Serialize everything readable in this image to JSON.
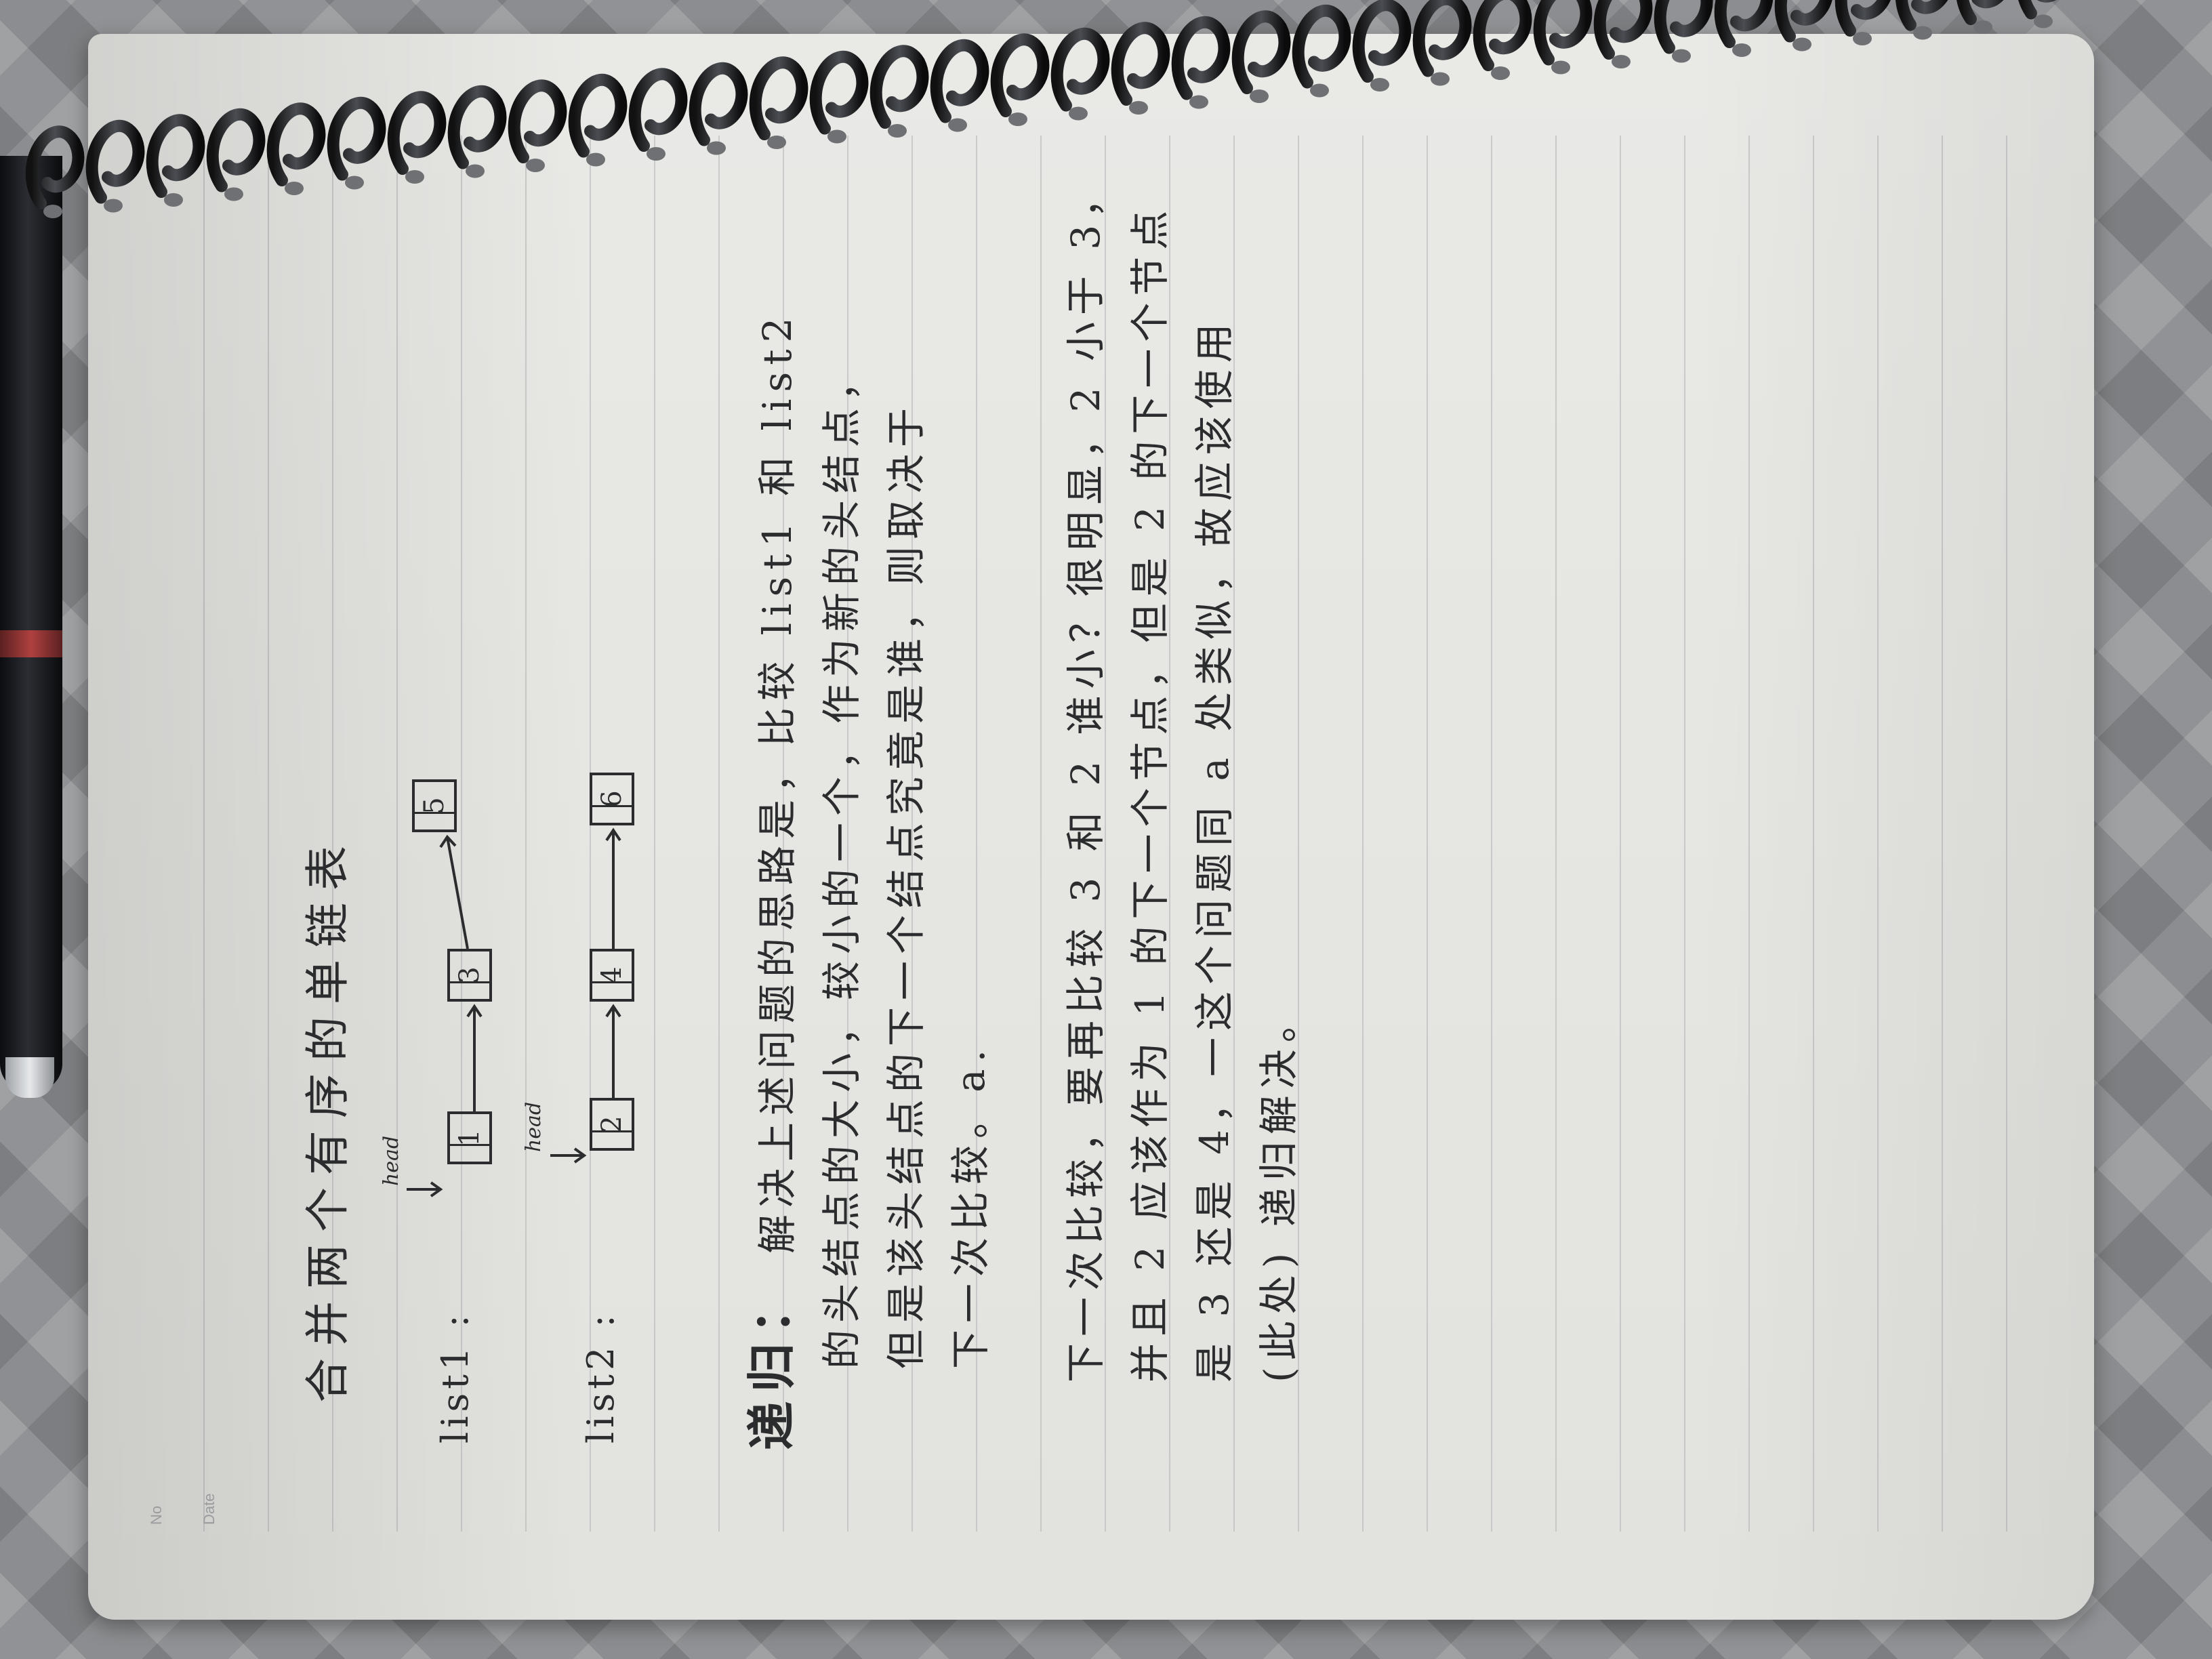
{
  "page_labels": {
    "no": "No",
    "date": "Date"
  },
  "title": "合并两个有序的单链表",
  "lists": [
    {
      "label": "list1 :",
      "head_label": "head",
      "nodes": [
        "1",
        "3",
        "5"
      ]
    },
    {
      "label": "list2 :",
      "head_label": "head",
      "nodes": [
        "2",
        "4",
        "6"
      ]
    }
  ],
  "section_heading": "递归：",
  "paragraph1": [
    "解决上述问题的思路是，比较 list1 和 list2",
    "的头结点的大小，较小的一个，作为新的头结点，",
    "但是该头结点的下一个结点究竟是谁，则取决于",
    "下一次比较。a."
  ],
  "paragraph2": [
    "下一次比较，要再比较 3 和 2 谁小？很明显，2 小于 3，",
    "并且 2 应该作为 1 的下一个节点，但是 2 的下一个节点",
    "是 3 还是 4，一这个问题同 a 处类似，故应该使用",
    "(此处) 递归解决。"
  ]
}
